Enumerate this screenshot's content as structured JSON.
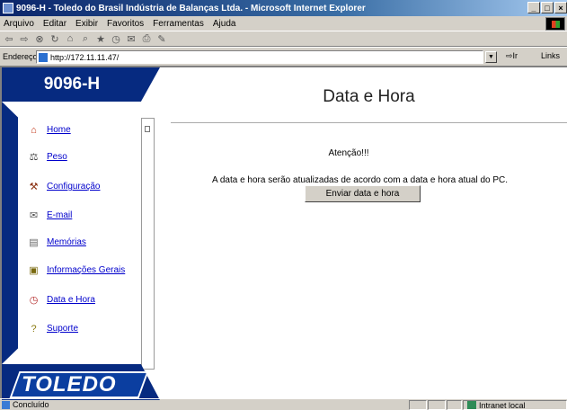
{
  "window": {
    "title": "9096-H - Toledo do Brasil Indústria de Balanças Ltda. - Microsoft Internet Explorer"
  },
  "menu": [
    "Arquivo",
    "Editar",
    "Exibir",
    "Favoritos",
    "Ferramentas",
    "Ajuda"
  ],
  "address": {
    "label": "Endereço",
    "url": "http://172.11.11.47/",
    "go_label": "Ir",
    "links_label": "Links"
  },
  "sidebar": {
    "header": "9096-H",
    "items": [
      {
        "label": "Home",
        "icon": "house-icon"
      },
      {
        "label": "Peso",
        "icon": "weights-icon"
      },
      {
        "label": "Configuração",
        "icon": "tools-icon"
      },
      {
        "label": "E-mail",
        "icon": "mail-icon"
      },
      {
        "label": "Memórias",
        "icon": "memory-icon"
      },
      {
        "label": "Informações Gerais",
        "icon": "info-icon"
      },
      {
        "label": "Data e Hora",
        "icon": "clock-icon"
      },
      {
        "label": "Suporte",
        "icon": "support-icon"
      }
    ],
    "footer_logo": "TOLEDO"
  },
  "main": {
    "title": "Data e Hora",
    "attention": "Atenção!!!",
    "message": "A data e hora serão atualizadas de acordo com a data e hora atual do PC.",
    "button": "Enviar data e hora"
  },
  "status": {
    "text": "Concluído",
    "zone": "Intranet local"
  },
  "colors": {
    "sidebar_blue": "#062a80",
    "link": "#0000cc"
  }
}
